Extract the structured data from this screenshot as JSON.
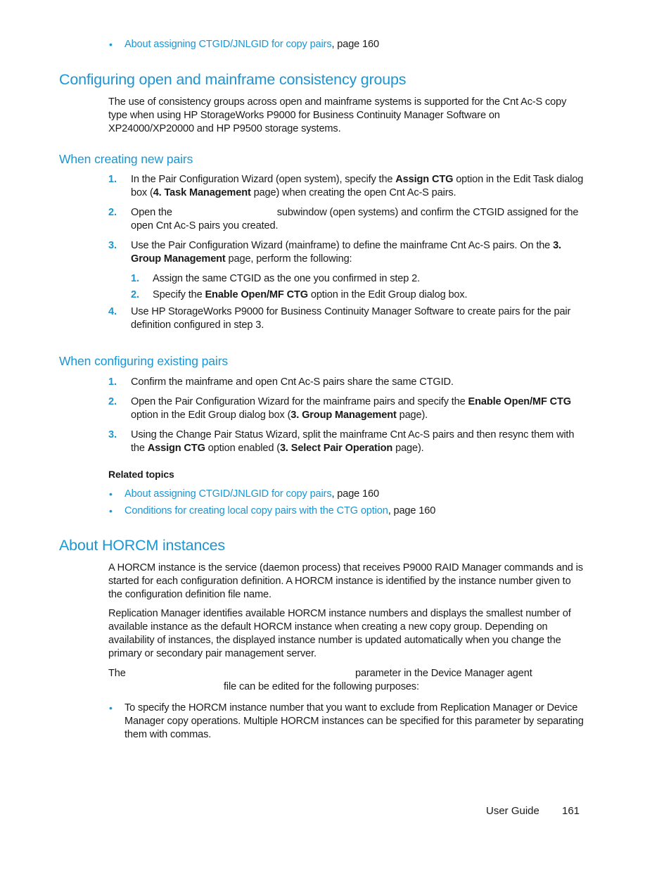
{
  "top_links": [
    {
      "link": "About assigning CTGID/JNLGID for copy pairs",
      "suffix": ", page 160"
    }
  ],
  "section1": {
    "title": "Configuring open and mainframe consistency groups",
    "intro": "The use of consistency groups across open and mainframe systems is supported for the Cnt Ac-S copy type when using HP StorageWorks P9000 for Business Continuity Manager Software on XP24000/XP20000 and HP P9500 storage systems.",
    "sub1": {
      "title": "When creating new pairs",
      "steps": [
        {
          "num": "1.",
          "a": "In the Pair Configuration Wizard (open system), specify the ",
          "b1": "Assign CTG",
          "c": " option in the Edit Task dialog box (",
          "b2": "4. Task Management",
          "d": " page) when creating the open Cnt Ac-S pairs."
        },
        {
          "num": "2.",
          "a": "Open the ",
          "gap": "",
          "c": "subwindow (open systems) and confirm the CTGID assigned for the open Cnt Ac-S pairs you created."
        },
        {
          "num": "3.",
          "a": "Use the Pair Configuration Wizard (mainframe) to define the mainframe Cnt Ac-S pairs. On the ",
          "b1": "3. Group Management",
          "c": " page, perform the following:",
          "substeps": [
            {
              "num": "1.",
              "text": "Assign the same CTGID as the one you confirmed in step 2."
            },
            {
              "num": "2.",
              "a": "Specify the ",
              "b1": "Enable Open/MF CTG",
              "c": "  option in the Edit Group dialog box."
            }
          ]
        },
        {
          "num": "4.",
          "text": "Use HP StorageWorks P9000 for Business Continuity Manager Software to create pairs for the pair definition configured in step 3."
        }
      ]
    },
    "sub2": {
      "title": "When configuring existing pairs",
      "steps": [
        {
          "num": "1.",
          "text": "Confirm the mainframe and open Cnt Ac-S pairs share the same CTGID."
        },
        {
          "num": "2.",
          "a": "Open the Pair Configuration Wizard for the mainframe pairs and specify the ",
          "b1": "Enable Open/MF CTG",
          "c": " option in the Edit Group dialog box (",
          "b2": "3. Group Management",
          "d": " page)."
        },
        {
          "num": "3.",
          "a": "Using the Change Pair Status Wizard, split the mainframe Cnt Ac-S pairs and then resync them with the ",
          "b1": "Assign CTG",
          "c": " option enabled (",
          "b2": "3. Select Pair Operation",
          "d": " page)."
        }
      ]
    },
    "related": {
      "heading": "Related topics",
      "links": [
        {
          "link": "About assigning CTGID/JNLGID for copy pairs",
          "suffix": ", page 160"
        },
        {
          "link": "Conditions for creating local copy pairs with the CTG option",
          "suffix": ", page 160"
        }
      ]
    }
  },
  "section2": {
    "title": "About HORCM instances",
    "p1": "A HORCM instance is the service (daemon process) that receives P9000 RAID Manager commands and is started for each configuration definition. A HORCM instance is identified by the instance number given to the configuration definition file name.",
    "p2": "Replication Manager identifies available HORCM instance numbers and displays the smallest number of available instance as the default HORCM instance when creating a new copy group. Depending on availability of instances, the displayed instance number is updated automatically when you change the primary or secondary pair management server.",
    "p3_start": "The",
    "p3_mid": "parameter in the Device Manager agent",
    "p3_end": "file can be edited for the following purposes:",
    "bullets": [
      "To specify the HORCM instance number that you want to exclude from Replication Manager or Device Manager copy operations. Multiple HORCM instances can be specified for this parameter by separating them with commas."
    ]
  },
  "footer": {
    "guide": "User Guide",
    "page": "161"
  }
}
